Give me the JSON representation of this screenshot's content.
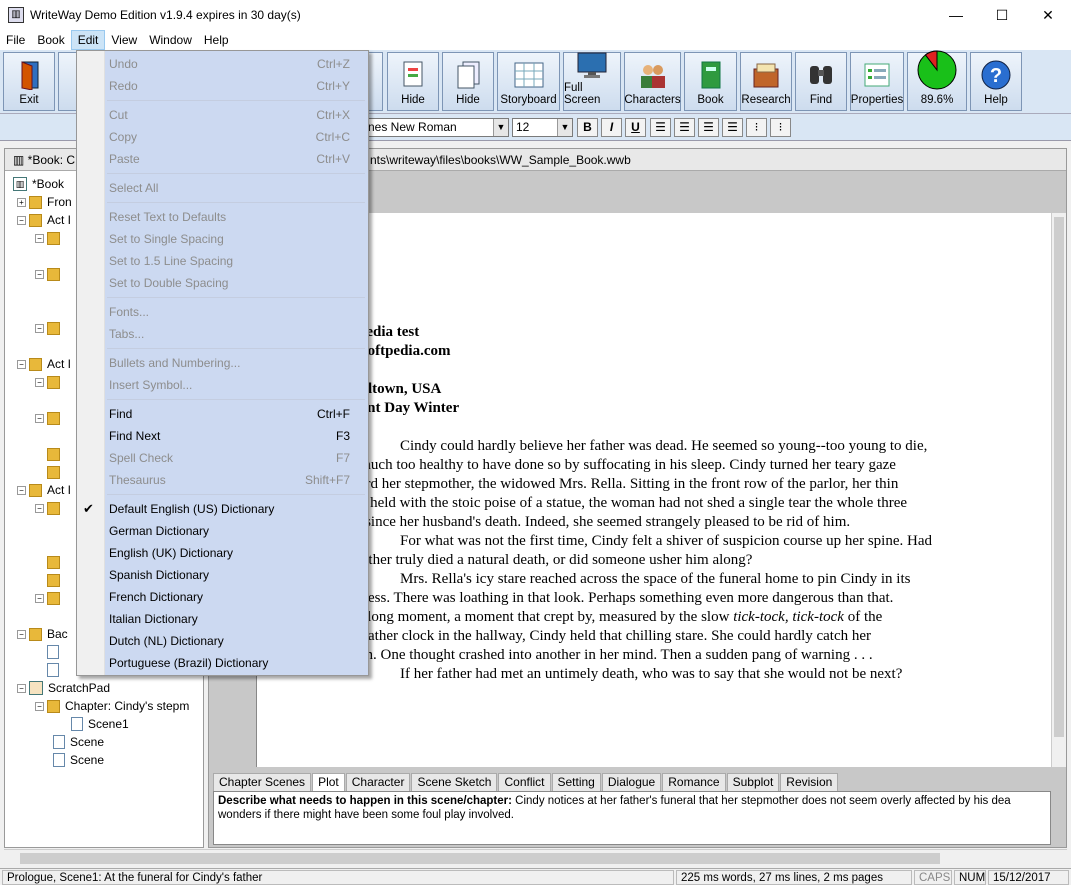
{
  "window": {
    "title": "WriteWay Demo Edition v1.9.4  expires in 30 day(s)"
  },
  "menubar": [
    "File",
    "Book",
    "Edit",
    "View",
    "Window",
    "Help"
  ],
  "toolbar": [
    {
      "label": "Exit",
      "icon": "exit-door-icon"
    },
    {
      "label": "Hide",
      "icon": "hide-doc-icon"
    },
    {
      "label": "Hide",
      "icon": "hide-pages-icon"
    },
    {
      "label": "Storyboard",
      "icon": "storyboard-icon"
    },
    {
      "label": "Full Screen",
      "icon": "monitor-icon"
    },
    {
      "label": "Characters",
      "icon": "characters-icon"
    },
    {
      "label": "Book",
      "icon": "book-icon"
    },
    {
      "label": "Research",
      "icon": "research-icon"
    },
    {
      "label": "Find",
      "icon": "binoculars-icon"
    },
    {
      "label": "Properties",
      "icon": "properties-icon"
    },
    {
      "label": "89.6%",
      "icon": "progress-pie-icon",
      "progress": 0.896
    },
    {
      "label": "Help",
      "icon": "help-icon"
    }
  ],
  "format": {
    "font": "nes New Roman",
    "size": "12",
    "buttons": [
      "B",
      "I",
      "U"
    ]
  },
  "left_pane": {
    "header": "*Book: C"
  },
  "tree": [
    {
      "label": "*Book",
      "kind": "book"
    },
    {
      "label": "Fron",
      "kind": "folder"
    },
    {
      "label": "Act I",
      "kind": "folder"
    },
    {
      "label": "Act I",
      "kind": "folder"
    },
    {
      "label": "Act I",
      "kind": "folder"
    },
    {
      "label": "Bac",
      "kind": "folder"
    },
    {
      "label": "ScratchPad",
      "kind": "scratch"
    },
    {
      "label": "Chapter: Cindy's stepm",
      "kind": "folder"
    },
    {
      "label": "Scene1",
      "kind": "doc"
    },
    {
      "label": "Scene",
      "kind": "doc"
    },
    {
      "label": "Scene",
      "kind": "doc"
    }
  ],
  "editor": {
    "path": "nts\\writeway\\files\\books\\WW_Sample_Book.wwb",
    "lines": [
      {
        "text": "ftpedia test",
        "bold": true
      },
      {
        "text": "w.softpedia.com",
        "bold": true
      },
      {
        "text": "nalltown, USA",
        "bold": true
      },
      {
        "text": "esent Day Winter",
        "bold": true
      },
      {
        "text": "Cindy could hardly believe her father was dead. He seemed so young--too young to die,",
        "indent": true
      },
      {
        "text": "d much too healthy to have done so by suffocating in his sleep. Cindy turned her teary gaze"
      },
      {
        "text": "ward her stepmother, the widowed Mrs. Rella. Sitting in the front row of the parlor, her thin"
      },
      {
        "text": "me held with the stoic poise of a statue, the woman had not shed a single tear the whole three"
      },
      {
        "text": "ys since her husband's death. Indeed, she seemed strangely pleased to be rid of him."
      },
      {
        "text": "For what was not the first time, Cindy felt a shiver of suspicion course up her spine. Had",
        "indent": true
      },
      {
        "text": "r father truly died a natural death, or did someone usher him along?"
      },
      {
        "text": "Mrs. Rella's icy stare reached across the space of the funeral home to pin Cindy in its",
        "indent": true
      },
      {
        "text": "rpness. There was loathing in that look. Perhaps something even more dangerous than that."
      },
      {
        "text_parts": [
          "r a long moment, a moment that crept by, measured by the slow ",
          "tick-tock, tick-tock",
          " of the"
        ]
      },
      {
        "text": "ndfather clock in the hallway, Cindy held that chilling stare. She could hardly catch her"
      },
      {
        "text": "eath. One thought crashed into another in her mind. Then a sudden pang of warning . . ."
      },
      {
        "text": "If her father had met an untimely death, who was to say that she would not be next?",
        "indent": true
      }
    ]
  },
  "tabs": [
    "Chapter Scenes",
    "Plot",
    "Character",
    "Scene Sketch",
    "Conflict",
    "Setting",
    "Dialogue",
    "Romance",
    "Subplot",
    "Revision"
  ],
  "selected_tab": "Plot",
  "notes": {
    "label": "Describe what needs to happen in this scene/chapter:",
    "text1": " Cindy notices at her father's funeral that her stepmother does not seem overly affected by his dea",
    "text2": "wonders if there might have been some foul play involved."
  },
  "status": {
    "scene": "Prologue, Scene1: At the funeral for Cindy's father",
    "stats": "225 ms words, 27 ms lines, 2 ms pages",
    "caps": "CAPS",
    "num": "NUM",
    "date": "15/12/2017"
  },
  "edit_menu": [
    {
      "label": "Undo",
      "shortcut": "Ctrl+Z",
      "disabled": true
    },
    {
      "label": "Redo",
      "shortcut": "Ctrl+Y",
      "disabled": true
    },
    {
      "sep": true
    },
    {
      "label": "Cut",
      "shortcut": "Ctrl+X",
      "disabled": true
    },
    {
      "label": "Copy",
      "shortcut": "Ctrl+C",
      "disabled": true
    },
    {
      "label": "Paste",
      "shortcut": "Ctrl+V",
      "disabled": true
    },
    {
      "sep": true
    },
    {
      "label": "Select All",
      "shortcut": "",
      "disabled": true
    },
    {
      "sep": true
    },
    {
      "label": "Reset Text to Defaults",
      "shortcut": "",
      "disabled": true
    },
    {
      "label": "Set to Single Spacing",
      "shortcut": "",
      "disabled": true
    },
    {
      "label": "Set to 1.5 Line Spacing",
      "shortcut": "",
      "disabled": true
    },
    {
      "label": "Set to Double Spacing",
      "shortcut": "",
      "disabled": true
    },
    {
      "sep": true
    },
    {
      "label": "Fonts...",
      "shortcut": "",
      "disabled": true
    },
    {
      "label": "Tabs...",
      "shortcut": "",
      "disabled": true
    },
    {
      "sep": true
    },
    {
      "label": "Bullets and Numbering...",
      "shortcut": "",
      "disabled": true
    },
    {
      "label": "Insert Symbol...",
      "shortcut": "",
      "disabled": true
    },
    {
      "sep": true
    },
    {
      "label": "Find",
      "shortcut": "Ctrl+F",
      "disabled": false
    },
    {
      "label": "Find Next",
      "shortcut": "F3",
      "disabled": false
    },
    {
      "label": "Spell Check",
      "shortcut": "F7",
      "disabled": true
    },
    {
      "label": "Thesaurus",
      "shortcut": "Shift+F7",
      "disabled": true
    },
    {
      "sep": true
    },
    {
      "label": "Default English (US) Dictionary",
      "shortcut": "",
      "disabled": false,
      "checked": true
    },
    {
      "label": "German Dictionary",
      "shortcut": "",
      "disabled": false
    },
    {
      "label": "English (UK) Dictionary",
      "shortcut": "",
      "disabled": false
    },
    {
      "label": "Spanish Dictionary",
      "shortcut": "",
      "disabled": false
    },
    {
      "label": "French Dictionary",
      "shortcut": "",
      "disabled": false
    },
    {
      "label": "Italian Dictionary",
      "shortcut": "",
      "disabled": false
    },
    {
      "label": "Dutch (NL) Dictionary",
      "shortcut": "",
      "disabled": false
    },
    {
      "label": "Portuguese (Brazil) Dictionary",
      "shortcut": "",
      "disabled": false
    }
  ]
}
